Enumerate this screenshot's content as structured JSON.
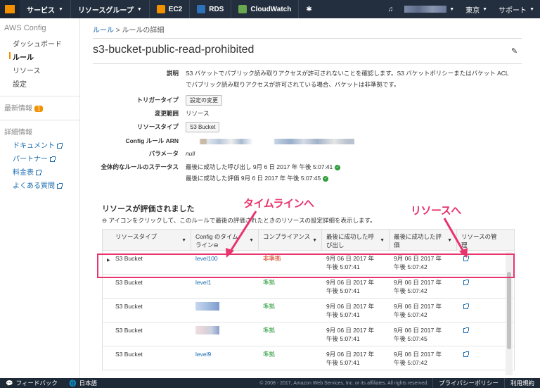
{
  "topnav": {
    "services": "サービス",
    "resource_groups": "リソースグループ",
    "ec2": "EC2",
    "rds": "RDS",
    "cloudwatch": "CloudWatch",
    "region": "東京",
    "support": "サポート"
  },
  "sidebar": {
    "title": "AWS Config",
    "items": [
      {
        "label": "ダッシュボード"
      },
      {
        "label": "ルール"
      },
      {
        "label": "リソース"
      },
      {
        "label": "設定"
      }
    ],
    "latest_info": "最新情報",
    "latest_badge": "1",
    "details_title": "詳細情報",
    "links": [
      {
        "label": "ドキュメント"
      },
      {
        "label": "パートナー"
      },
      {
        "label": "料金表"
      },
      {
        "label": "よくある質問"
      }
    ]
  },
  "breadcrumb": {
    "root": "ルール",
    "sep": " > ",
    "current": "ルールの詳細"
  },
  "page_title": "s3-bucket-public-read-prohibited",
  "details": {
    "desc_label": "説明",
    "desc_line1": "S3 バケットでパブリック読み取りアクセスが許可されないことを確認します。S3 バケットポリシーまたはバケット ACL",
    "desc_line2": "でパブリック読み取りアクセスが許可されている場合、バケットは非準拠です。",
    "trigger_label": "トリガータイプ",
    "trigger_button": "設定の変更",
    "scope_label": "変更範囲",
    "scope_value": "リソース",
    "resource_type_label": "リソースタイプ",
    "resource_type_value": "S3 Bucket",
    "arn_label": "Config ルール ARN",
    "params_label": "パラメータ",
    "params_value": "null",
    "status_label": "全体的なルールのステータス",
    "status_line1": "最後に成功した呼び出し 9月 6 日 2017 年 午後 5:07:41",
    "status_line2": "最後に成功した評価 9月 6 日 2017 年 午後 5:07:45"
  },
  "resources": {
    "title": "リソースが評価されました",
    "note": " アイコンをクリックして、このルールで最後の評価されたときのリソースの設定詳細を表示します。",
    "headers": {
      "resource_type": "リソースタイプ",
      "timeline_line1": "Config のタイム",
      "timeline_line2": "ライン",
      "compliance": "コンプライアンス",
      "last_invoke_line1": "最後に成功した呼",
      "last_invoke_line2": "び出し",
      "last_eval_line1": "最後に成功した評",
      "last_eval_line2": "価",
      "manage_line1": "リソースの管",
      "manage_line2": "理"
    },
    "rows": [
      {
        "type": "S3 Bucket",
        "timeline": "level100",
        "compliance": "非準拠",
        "invoke1": "9月 06 日 2017 年",
        "invoke2": "午後 5:07:41",
        "eval1": "9月 06 日 2017 年",
        "eval2": "午後 5:07:42"
      },
      {
        "type": "S3 Bucket",
        "timeline": "level1",
        "compliance": "準拠",
        "invoke1": "9月 06 日 2017 年",
        "invoke2": "午後 5:07:41",
        "eval1": "9月 06 日 2017 年",
        "eval2": "午後 5:07:42"
      },
      {
        "type": "S3 Bucket",
        "timeline": "",
        "compliance": "準拠",
        "invoke1": "9月 06 日 2017 年",
        "invoke2": "午後 5:07:41",
        "eval1": "9月 06 日 2017 年",
        "eval2": "午後 5:07:42"
      },
      {
        "type": "S3 Bucket",
        "timeline": "",
        "compliance": "準拠",
        "invoke1": "9月 06 日 2017 年",
        "invoke2": "午後 5:07:41",
        "eval1": "9月 06 日 2017 年",
        "eval2": "午後 5:07:45"
      },
      {
        "type": "S3 Bucket",
        "timeline": "level9",
        "compliance": "準拠",
        "invoke1": "9月 06 日 2017 年",
        "invoke2": "午後 5:07:41",
        "eval1": "9月 06 日 2017 年",
        "eval2": "午後 5:07:42"
      }
    ]
  },
  "annotations": {
    "timeline": "タイムラインへ",
    "resource": "リソースへ",
    "color": "#e8336d"
  },
  "footer": {
    "feedback": "フィードバック",
    "language": "日本語",
    "copyright": "© 2008 - 2017, Amazon Web Services, Inc. or its affiliates. All rights reserved.",
    "privacy": "プライバシーポリシー",
    "terms": "利用規約"
  }
}
